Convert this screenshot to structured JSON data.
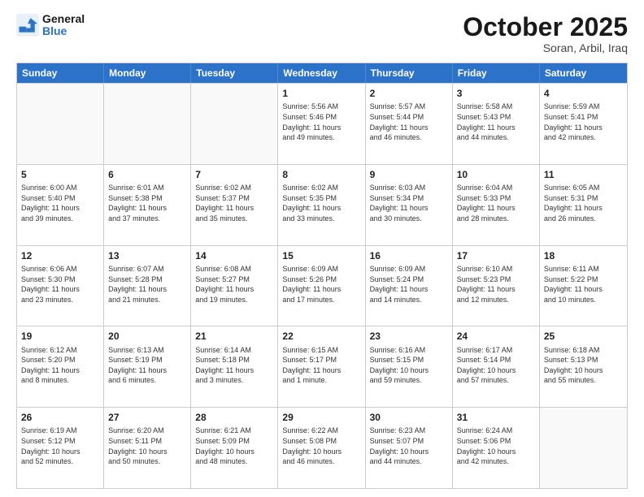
{
  "header": {
    "logo_general": "General",
    "logo_blue": "Blue",
    "month": "October 2025",
    "location": "Soran, Arbil, Iraq"
  },
  "weekdays": [
    "Sunday",
    "Monday",
    "Tuesday",
    "Wednesday",
    "Thursday",
    "Friday",
    "Saturday"
  ],
  "rows": [
    [
      {
        "day": "",
        "text": ""
      },
      {
        "day": "",
        "text": ""
      },
      {
        "day": "",
        "text": ""
      },
      {
        "day": "1",
        "text": "Sunrise: 5:56 AM\nSunset: 5:46 PM\nDaylight: 11 hours\nand 49 minutes."
      },
      {
        "day": "2",
        "text": "Sunrise: 5:57 AM\nSunset: 5:44 PM\nDaylight: 11 hours\nand 46 minutes."
      },
      {
        "day": "3",
        "text": "Sunrise: 5:58 AM\nSunset: 5:43 PM\nDaylight: 11 hours\nand 44 minutes."
      },
      {
        "day": "4",
        "text": "Sunrise: 5:59 AM\nSunset: 5:41 PM\nDaylight: 11 hours\nand 42 minutes."
      }
    ],
    [
      {
        "day": "5",
        "text": "Sunrise: 6:00 AM\nSunset: 5:40 PM\nDaylight: 11 hours\nand 39 minutes."
      },
      {
        "day": "6",
        "text": "Sunrise: 6:01 AM\nSunset: 5:38 PM\nDaylight: 11 hours\nand 37 minutes."
      },
      {
        "day": "7",
        "text": "Sunrise: 6:02 AM\nSunset: 5:37 PM\nDaylight: 11 hours\nand 35 minutes."
      },
      {
        "day": "8",
        "text": "Sunrise: 6:02 AM\nSunset: 5:35 PM\nDaylight: 11 hours\nand 33 minutes."
      },
      {
        "day": "9",
        "text": "Sunrise: 6:03 AM\nSunset: 5:34 PM\nDaylight: 11 hours\nand 30 minutes."
      },
      {
        "day": "10",
        "text": "Sunrise: 6:04 AM\nSunset: 5:33 PM\nDaylight: 11 hours\nand 28 minutes."
      },
      {
        "day": "11",
        "text": "Sunrise: 6:05 AM\nSunset: 5:31 PM\nDaylight: 11 hours\nand 26 minutes."
      }
    ],
    [
      {
        "day": "12",
        "text": "Sunrise: 6:06 AM\nSunset: 5:30 PM\nDaylight: 11 hours\nand 23 minutes."
      },
      {
        "day": "13",
        "text": "Sunrise: 6:07 AM\nSunset: 5:28 PM\nDaylight: 11 hours\nand 21 minutes."
      },
      {
        "day": "14",
        "text": "Sunrise: 6:08 AM\nSunset: 5:27 PM\nDaylight: 11 hours\nand 19 minutes."
      },
      {
        "day": "15",
        "text": "Sunrise: 6:09 AM\nSunset: 5:26 PM\nDaylight: 11 hours\nand 17 minutes."
      },
      {
        "day": "16",
        "text": "Sunrise: 6:09 AM\nSunset: 5:24 PM\nDaylight: 11 hours\nand 14 minutes."
      },
      {
        "day": "17",
        "text": "Sunrise: 6:10 AM\nSunset: 5:23 PM\nDaylight: 11 hours\nand 12 minutes."
      },
      {
        "day": "18",
        "text": "Sunrise: 6:11 AM\nSunset: 5:22 PM\nDaylight: 11 hours\nand 10 minutes."
      }
    ],
    [
      {
        "day": "19",
        "text": "Sunrise: 6:12 AM\nSunset: 5:20 PM\nDaylight: 11 hours\nand 8 minutes."
      },
      {
        "day": "20",
        "text": "Sunrise: 6:13 AM\nSunset: 5:19 PM\nDaylight: 11 hours\nand 6 minutes."
      },
      {
        "day": "21",
        "text": "Sunrise: 6:14 AM\nSunset: 5:18 PM\nDaylight: 11 hours\nand 3 minutes."
      },
      {
        "day": "22",
        "text": "Sunrise: 6:15 AM\nSunset: 5:17 PM\nDaylight: 11 hours\nand 1 minute."
      },
      {
        "day": "23",
        "text": "Sunrise: 6:16 AM\nSunset: 5:15 PM\nDaylight: 10 hours\nand 59 minutes."
      },
      {
        "day": "24",
        "text": "Sunrise: 6:17 AM\nSunset: 5:14 PM\nDaylight: 10 hours\nand 57 minutes."
      },
      {
        "day": "25",
        "text": "Sunrise: 6:18 AM\nSunset: 5:13 PM\nDaylight: 10 hours\nand 55 minutes."
      }
    ],
    [
      {
        "day": "26",
        "text": "Sunrise: 6:19 AM\nSunset: 5:12 PM\nDaylight: 10 hours\nand 52 minutes."
      },
      {
        "day": "27",
        "text": "Sunrise: 6:20 AM\nSunset: 5:11 PM\nDaylight: 10 hours\nand 50 minutes."
      },
      {
        "day": "28",
        "text": "Sunrise: 6:21 AM\nSunset: 5:09 PM\nDaylight: 10 hours\nand 48 minutes."
      },
      {
        "day": "29",
        "text": "Sunrise: 6:22 AM\nSunset: 5:08 PM\nDaylight: 10 hours\nand 46 minutes."
      },
      {
        "day": "30",
        "text": "Sunrise: 6:23 AM\nSunset: 5:07 PM\nDaylight: 10 hours\nand 44 minutes."
      },
      {
        "day": "31",
        "text": "Sunrise: 6:24 AM\nSunset: 5:06 PM\nDaylight: 10 hours\nand 42 minutes."
      },
      {
        "day": "",
        "text": ""
      }
    ]
  ]
}
